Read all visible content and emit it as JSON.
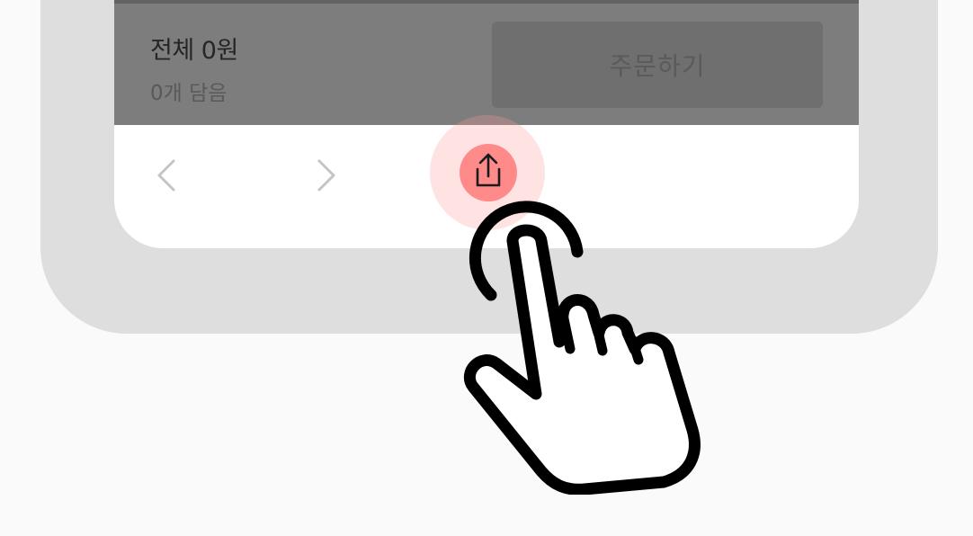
{
  "order_bar": {
    "total_label": "전체 0원",
    "count_label": "0개 담음",
    "order_button_label": "주문하기"
  },
  "nav": {
    "back_icon": "chevron-left-icon",
    "forward_icon": "chevron-right-icon",
    "share_icon": "share-icon"
  },
  "overlay": {
    "gesture_icon": "tap-hand-icon"
  },
  "colors": {
    "highlight": "#ff8a8a",
    "overlay_dim": "#7d7d7d",
    "frame": "#dedede"
  }
}
